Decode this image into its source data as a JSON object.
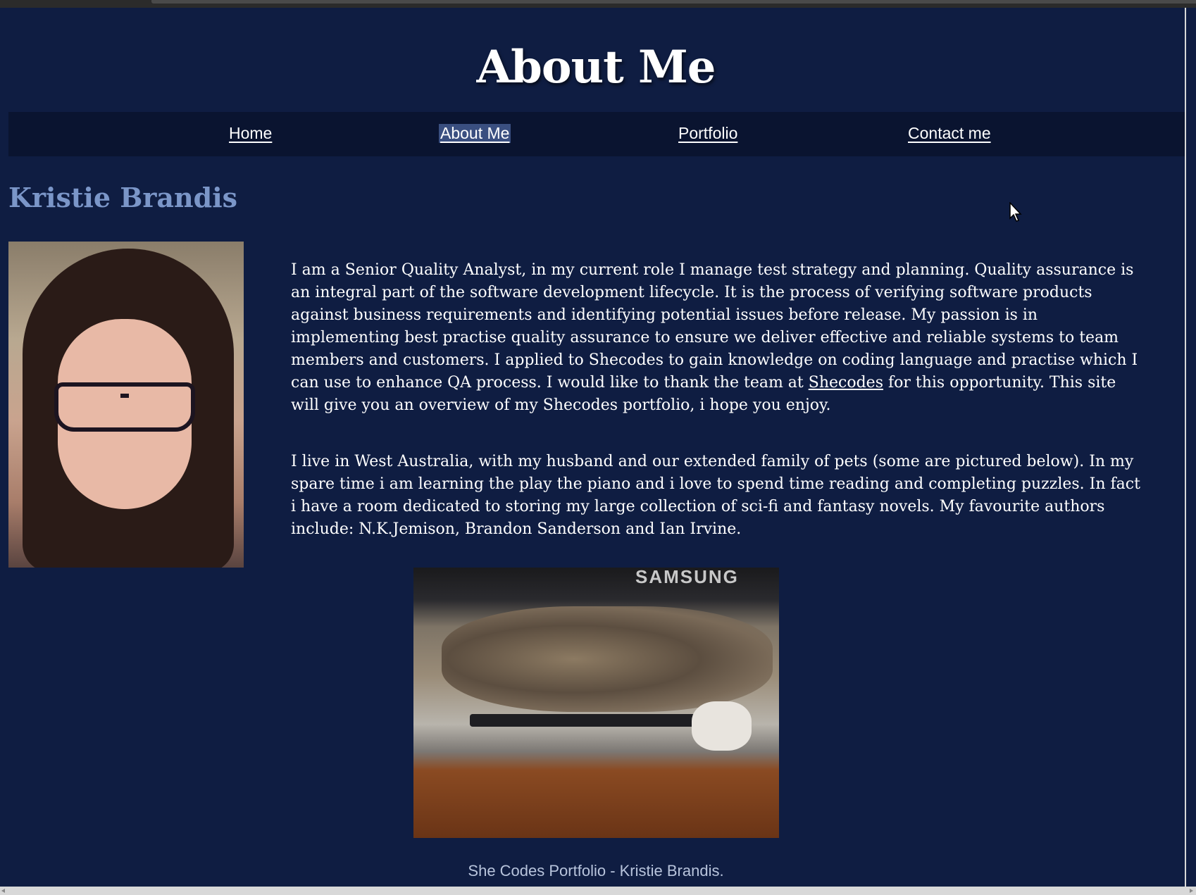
{
  "page": {
    "title": "About Me"
  },
  "nav": {
    "items": [
      {
        "label": "Home"
      },
      {
        "label": "About Me",
        "active": true
      },
      {
        "label": "Portfolio"
      },
      {
        "label": "Contact me"
      }
    ]
  },
  "profile": {
    "name": "Kristie Brandis"
  },
  "bio": {
    "paragraph1_before_link": "I am a Senior Quality Analyst, in my current role I manage test strategy and planning. Quality assurance is an integral part of the software development lifecycle. It is the process of verifying software products against business requirements and identifying potential issues before release. My passion is in implementing best practise quality assurance to ensure we deliver effective and reliable systems to team members and customers. I applied to Shecodes to gain knowledge on coding language and practise which I can use to enhance QA process. I would like to thank the team at ",
    "paragraph1_link": "Shecodes",
    "paragraph1_after_link": " for this opportunity. This site will give you an overview of my Shecodes portfolio, i hope you enjoy.",
    "paragraph2": "I live in West Australia, with my husband and our extended family of pets (some are pictured below). In my spare time i am learning the play the piano and i love to spend time reading and completing puzzles. In fact i have a room dedicated to storing my large collection of sci-fi and fantasy novels. My favourite authors include: N.K.Jemison, Brandon Sanderson and Ian Irvine."
  },
  "cat_photo": {
    "brand_text": "SAMSUNG"
  },
  "footer": {
    "text": "She Codes Portfolio - Kristie Brandis."
  },
  "colors": {
    "background": "#0f1d42",
    "navbar": "#0a1430",
    "name_heading": "#7b96c8",
    "active_nav_highlight": "#3a4f80"
  },
  "icons": {
    "cursor": "mouse-pointer-icon"
  }
}
